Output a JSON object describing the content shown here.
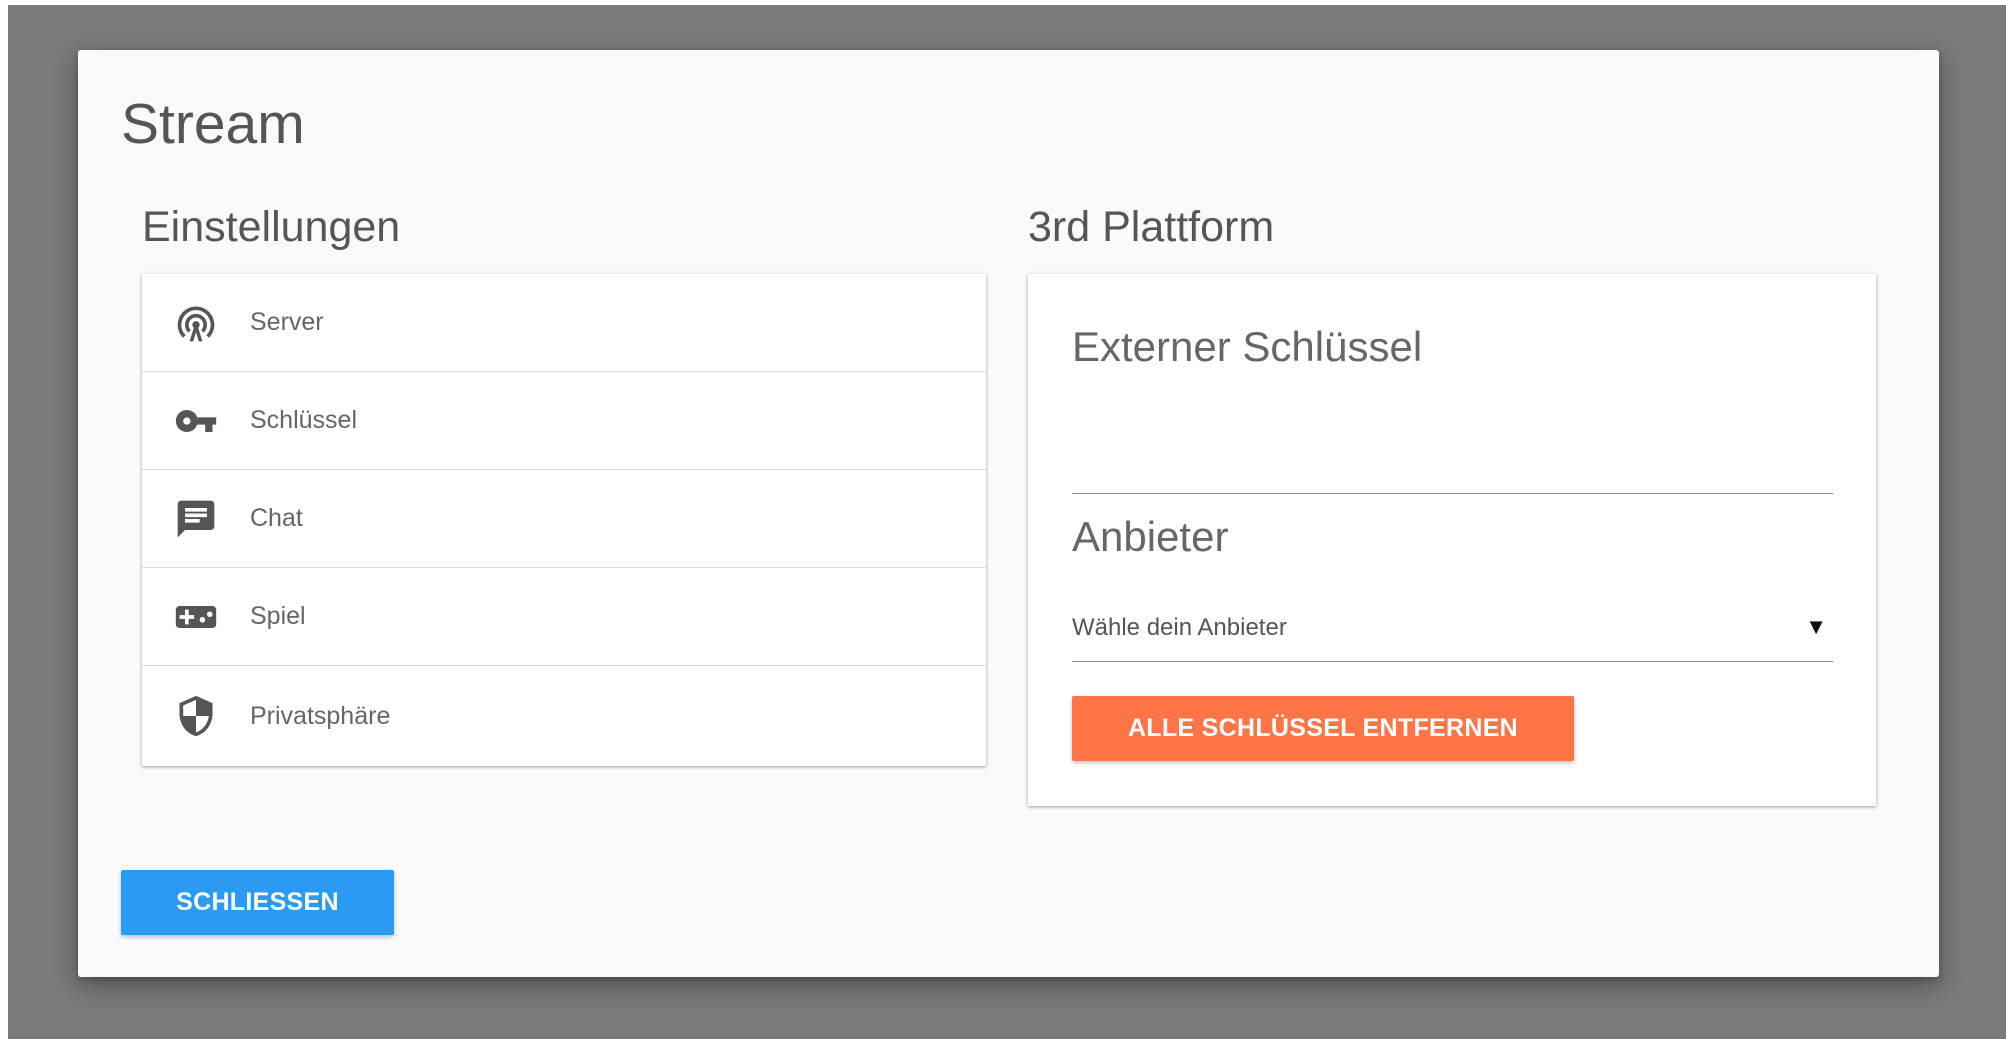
{
  "dialog": {
    "title": "Stream",
    "close_label": "SCHLIESSEN"
  },
  "settings": {
    "title": "Einstellungen",
    "items": [
      {
        "label": "Server",
        "icon": "antenna-icon"
      },
      {
        "label": "Schlüssel",
        "icon": "key-icon"
      },
      {
        "label": "Chat",
        "icon": "chat-icon"
      },
      {
        "label": "Spiel",
        "icon": "gamepad-icon"
      },
      {
        "label": "Privatsphäre",
        "icon": "shield-icon"
      }
    ]
  },
  "platform": {
    "title": "3rd Plattform",
    "key_label": "Externer Schlüssel",
    "key_value": "",
    "provider_label": "Anbieter",
    "provider_placeholder": "Wähle dein Anbieter",
    "remove_label": "ALLE SCHLÜSSEL ENTFERNEN"
  },
  "colors": {
    "backdrop": "#7a7a7a",
    "dialog_bg": "#fafafa",
    "accent_orange": "#ff7548",
    "accent_blue": "#2b9af3"
  }
}
